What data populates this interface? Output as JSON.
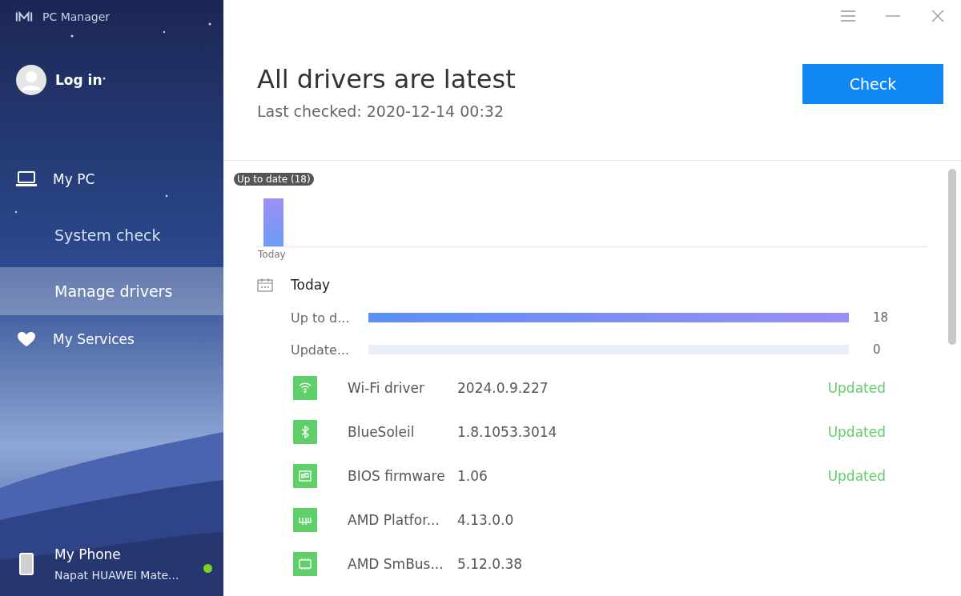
{
  "app": {
    "title": "PC Manager"
  },
  "account": {
    "label": "Log in"
  },
  "nav": [
    {
      "kind": "pc",
      "label": "My PC",
      "selected": false
    },
    {
      "kind": "sub",
      "label": "System check",
      "selected": false
    },
    {
      "kind": "sub",
      "label": "Manage drivers",
      "selected": true
    },
    {
      "kind": "services",
      "label": "My Services",
      "selected": false
    }
  ],
  "phone": {
    "title": "My Phone",
    "device": "Napat HUAWEI Mate...",
    "connected": true
  },
  "header": {
    "title": "All drivers are latest",
    "subtitle": "Last checked: 2020-12-14 00:32",
    "button": "Check"
  },
  "chart": {
    "tooltip": "Up to date (18)",
    "category": "Today"
  },
  "summary": {
    "title": "Today",
    "rows": [
      {
        "label": "Up to d...",
        "level": 1,
        "count": "18"
      },
      {
        "label": "Update...",
        "level": 0,
        "count": "0"
      }
    ]
  },
  "drivers": [
    {
      "kind": "wifi",
      "name": "Wi-Fi driver",
      "version": "2024.0.9.227",
      "status": "Updated"
    },
    {
      "kind": "bluetooth",
      "name": "BlueSoleil",
      "version": "1.8.1053.3014",
      "status": "Updated"
    },
    {
      "kind": "bios",
      "name": "BIOS firmware",
      "version": "1.06",
      "status": "Updated"
    },
    {
      "kind": "platform",
      "name": "AMD Platfor...",
      "version": "4.13.0.0"
    },
    {
      "kind": "chip",
      "name": "AMD SmBus...",
      "version": "5.12.0.38"
    }
  ]
}
